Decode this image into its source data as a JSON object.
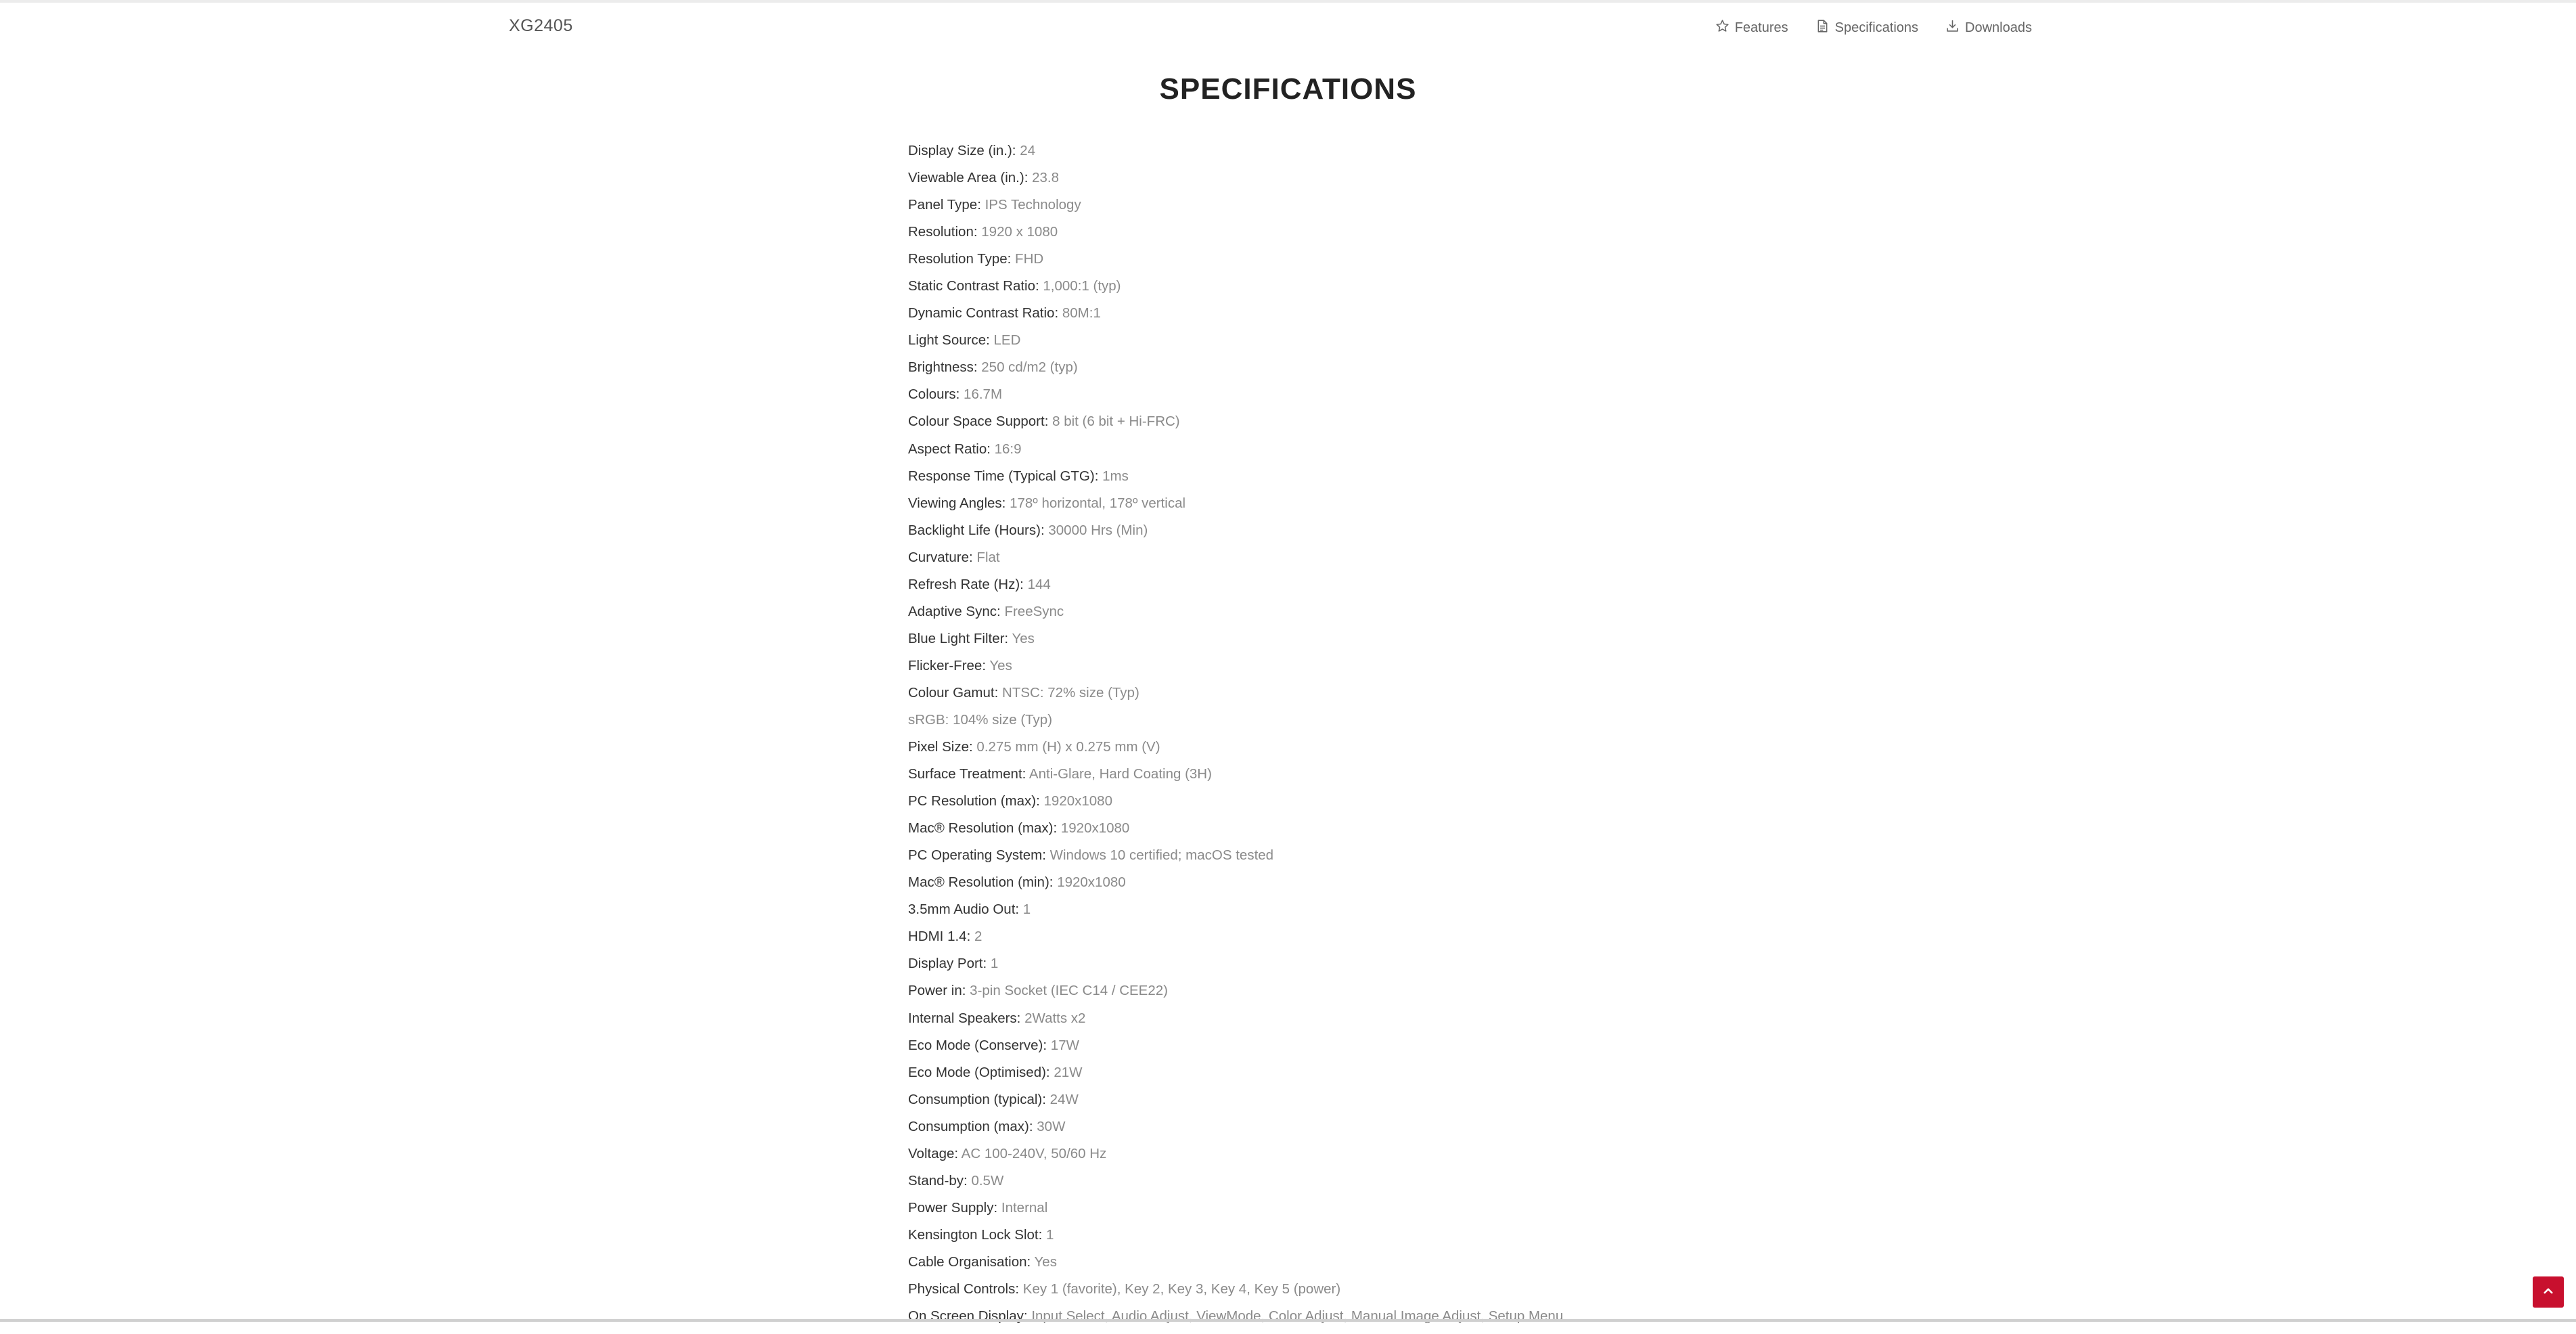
{
  "brand": "XG2405",
  "nav": {
    "items": [
      {
        "label": "Features",
        "icon": "star-icon"
      },
      {
        "label": "Specifications",
        "icon": "document-icon"
      },
      {
        "label": "Downloads",
        "icon": "download-icon"
      }
    ]
  },
  "page_title": "SPECIFICATIONS",
  "specs": [
    {
      "label": "Display Size (in.):",
      "value": "24"
    },
    {
      "label": "Viewable Area (in.):",
      "value": "23.8"
    },
    {
      "label": "Panel Type:",
      "value": "IPS Technology"
    },
    {
      "label": "Resolution:",
      "value": "1920 x 1080"
    },
    {
      "label": "Resolution Type:",
      "value": "FHD"
    },
    {
      "label": "Static Contrast Ratio:",
      "value": "1,000:1 (typ)"
    },
    {
      "label": "Dynamic Contrast Ratio:",
      "value": "80M:1"
    },
    {
      "label": "Light Source:",
      "value": "LED"
    },
    {
      "label": "Brightness:",
      "value": "250 cd/m2 (typ)"
    },
    {
      "label": "Colours:",
      "value": "16.7M"
    },
    {
      "label": "Colour Space Support:",
      "value": "8 bit (6 bit + Hi-FRC)"
    },
    {
      "label": "Aspect Ratio:",
      "value": "16:9"
    },
    {
      "label": "Response Time (Typical GTG):",
      "value": "1ms"
    },
    {
      "label": "Viewing Angles:",
      "value": "178º horizontal, 178º vertical"
    },
    {
      "label": "Backlight Life (Hours):",
      "value": "30000 Hrs (Min)"
    },
    {
      "label": "Curvature:",
      "value": "Flat"
    },
    {
      "label": "Refresh Rate (Hz):",
      "value": "144"
    },
    {
      "label": "Adaptive Sync:",
      "value": "FreeSync"
    },
    {
      "label": "Blue Light Filter:",
      "value": "Yes"
    },
    {
      "label": "Flicker-Free:",
      "value": "Yes"
    },
    {
      "label": "Colour Gamut:",
      "value": "NTSC: 72% size (Typ)"
    },
    {
      "label": "",
      "value": "sRGB: 104% size (Typ)"
    },
    {
      "label": "Pixel Size:",
      "value": "0.275 mm (H) x 0.275 mm (V)"
    },
    {
      "label": "Surface Treatment:",
      "value": "Anti-Glare, Hard Coating (3H)"
    },
    {
      "label": "PC Resolution (max):",
      "value": "1920x1080"
    },
    {
      "label": "Mac® Resolution (max):",
      "value": "1920x1080"
    },
    {
      "label": "PC Operating System:",
      "value": "Windows 10 certified; macOS tested"
    },
    {
      "label": "Mac® Resolution (min):",
      "value": "1920x1080"
    },
    {
      "label": "3.5mm Audio Out:",
      "value": "1"
    },
    {
      "label": "HDMI 1.4:",
      "value": "2"
    },
    {
      "label": "Display Port:",
      "value": "1"
    },
    {
      "label": "Power in:",
      "value": "3-pin Socket (IEC C14 / CEE22)"
    },
    {
      "label": "Internal Speakers:",
      "value": "2Watts x2"
    },
    {
      "label": "Eco Mode (Conserve):",
      "value": "17W"
    },
    {
      "label": "Eco Mode (Optimised):",
      "value": "21W"
    },
    {
      "label": "Consumption (typical):",
      "value": "24W"
    },
    {
      "label": "Consumption (max):",
      "value": "30W"
    },
    {
      "label": "Voltage:",
      "value": "AC 100-240V, 50/60 Hz"
    },
    {
      "label": "Stand-by:",
      "value": "0.5W"
    },
    {
      "label": "Power Supply:",
      "value": "Internal"
    },
    {
      "label": "Kensington Lock Slot:",
      "value": "1"
    },
    {
      "label": "Cable Organisation:",
      "value": "Yes"
    },
    {
      "label": "Physical Controls:",
      "value": "Key 1 (favorite), Key 2, Key 3, Key 4, Key 5 (power)"
    },
    {
      "label": "On Screen Display:",
      "value": "Input Select, Audio Adjust, ViewMode, Color Adjust, Manual Image Adjust, Setup Menu"
    }
  ],
  "back_to_top": {
    "icon": "chevron-up-icon",
    "color": "#c8102e"
  }
}
